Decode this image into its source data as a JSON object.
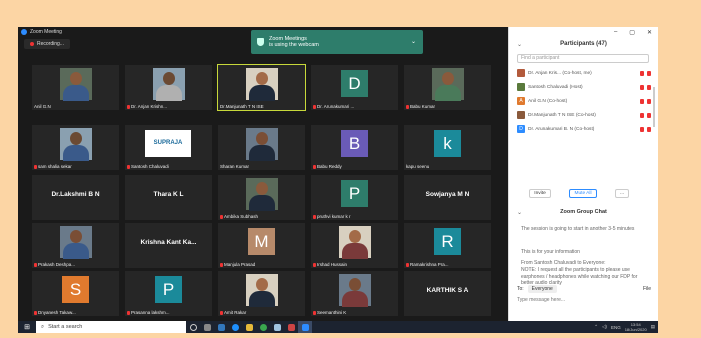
{
  "window": {
    "title": "Zoom Meeting",
    "recording": "Recording..."
  },
  "banner": {
    "line1": "Zoom Meetings",
    "line2": "is using the webcam"
  },
  "tiles": [
    {
      "name": "Anil G.N",
      "kind": "photo",
      "muted": false
    },
    {
      "name": "Dr. Anjan Krishn...",
      "kind": "photo",
      "muted": true
    },
    {
      "name": "Dr.Manjunath T N ISE",
      "kind": "photo",
      "muted": false
    },
    {
      "name": "Dr. Arunakumari ...",
      "kind": "letter",
      "letter": "D",
      "color": "#2e7d6b",
      "muted": true
    },
    {
      "name": "Babu Kumar",
      "kind": "photo",
      "muted": true
    },
    {
      "name": "sam shalia sekar",
      "kind": "photo",
      "muted": true
    },
    {
      "name": "Santosh Chaluvadi",
      "kind": "logo",
      "logo": "SUPRAJA",
      "muted": true
    },
    {
      "name": "Sharan Kumar",
      "kind": "photo",
      "muted": false
    },
    {
      "name": "Babu Reddy",
      "kind": "letter",
      "letter": "B",
      "color": "#6a5bb7",
      "muted": true
    },
    {
      "name": "kapu seenu",
      "kind": "letter",
      "letter": "k",
      "color": "#1b8a9a",
      "muted": false
    },
    {
      "name": "Dr.Lakshmi B N",
      "kind": "big",
      "muted": false
    },
    {
      "name": "Thara K L",
      "kind": "big",
      "muted": false
    },
    {
      "name": "Ambika Subhash",
      "kind": "photo",
      "muted": true
    },
    {
      "name": "pruthvi kumar k r",
      "kind": "letter",
      "letter": "P",
      "color": "#2e7d6b",
      "muted": true
    },
    {
      "name": "Sowjanya M N",
      "kind": "big",
      "muted": false
    },
    {
      "name": "Prakash Deshpa...",
      "kind": "photo",
      "muted": true
    },
    {
      "name": "Krishna Kant Ka...",
      "kind": "big",
      "muted": false
    },
    {
      "name": "Manjula Prasad",
      "kind": "letter",
      "letter": "M",
      "color": "#b78a6a",
      "muted": true
    },
    {
      "name": "Irshad Hussain",
      "kind": "photo",
      "muted": true
    },
    {
      "name": "Ramakrishna Pra...",
      "kind": "letter",
      "letter": "R",
      "color": "#1b8a9a",
      "muted": true
    },
    {
      "name": "Dnyanesh Takaw...",
      "kind": "letter",
      "letter": "S",
      "color": "#e07a2e",
      "muted": true
    },
    {
      "name": "Prasanna lakshm...",
      "kind": "letter",
      "letter": "P",
      "color": "#1b8a9a",
      "muted": true
    },
    {
      "name": "Amit Rakar",
      "kind": "photo",
      "muted": true
    },
    {
      "name": "Seemanthini K",
      "kind": "photo",
      "muted": true
    },
    {
      "name": "KARTHIK S A",
      "kind": "big",
      "muted": false
    }
  ],
  "panel": {
    "title": "Participants (47)",
    "search_placeholder": "Find a participant",
    "participants": [
      {
        "name": "Dr. Anjan Kris... (Co-host, me)",
        "avatar": "",
        "color": "#b35a3c"
      },
      {
        "name": "Santosh Chaluvadi (Host)",
        "avatar": "",
        "color": "#5a7a3c"
      },
      {
        "name": "Anil G.N (Co-host)",
        "avatar": "A",
        "color": "#e07a2e"
      },
      {
        "name": "Dr.Manjunath T N ISE (Co-host)",
        "avatar": "",
        "color": "#8a5a3c"
      },
      {
        "name": "Dr. Arunakumari B. N (Co-host)",
        "avatar": "D",
        "color": "#2d8cff"
      }
    ],
    "invite": "Invite",
    "mute_all": "Mute All",
    "more": "..."
  },
  "chat": {
    "title": "Zoom Group Chat",
    "messages": [
      {
        "text": "The session is going to start in another 3-5 minutes"
      },
      {
        "text": "This is for your information"
      },
      {
        "from": "From Santosh Chaluvadi to Everyone:",
        "text": "NOTE: I request all the participants to please use earphones / headphones while watching our FDP for better audio clarity"
      }
    ],
    "to_label": "To:",
    "to_value": "Everyone",
    "file": "File",
    "placeholder": "Type message here..."
  },
  "taskbar": {
    "search": "Start a search",
    "lang": "ENG",
    "time": "13:54",
    "date": "18/Jun/2020"
  },
  "colors": {
    "accent": "#2d8cff",
    "active_border": "#c7d83a",
    "banner": "#2e7d6b"
  }
}
